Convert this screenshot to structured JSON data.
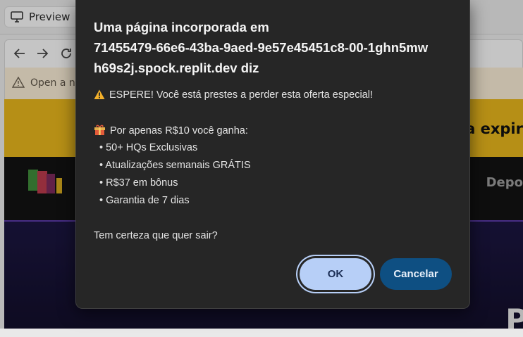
{
  "background": {
    "preview_tab_label": "Preview",
    "warning_bar_text": "Open a ne",
    "promo_text": "ta expir",
    "header_nav_text": "Depo",
    "hero_letter": "P"
  },
  "dialog": {
    "title_lines": [
      "Uma página incorporada em",
      "71455479-66e6-43ba-9aed-9e57e45451c8-00-1ghn5mw",
      "h69s2j.spock.replit.dev diz"
    ],
    "warning_line": "ESPERE! Você está prestes a perder esta oferta especial!",
    "offer_line": "Por apenas R$10 você ganha:",
    "bullets": [
      "• 50+ HQs Exclusivas",
      "• Atualizações semanais GRÁTIS",
      "• R$37 em bônus",
      "• Garantia de 7 dias"
    ],
    "question": "Tem certeza que quer sair?",
    "ok_label": "OK",
    "cancel_label": "Cancelar"
  },
  "colors": {
    "dialog_bg": "#262626",
    "ok_button": "#b7cff7",
    "cancel_button": "#0e4f82",
    "promo_bar": "#e4b31c"
  },
  "icons": {
    "warning": "warning-icon",
    "gift": "gift-icon",
    "monitor": "monitor-icon"
  }
}
